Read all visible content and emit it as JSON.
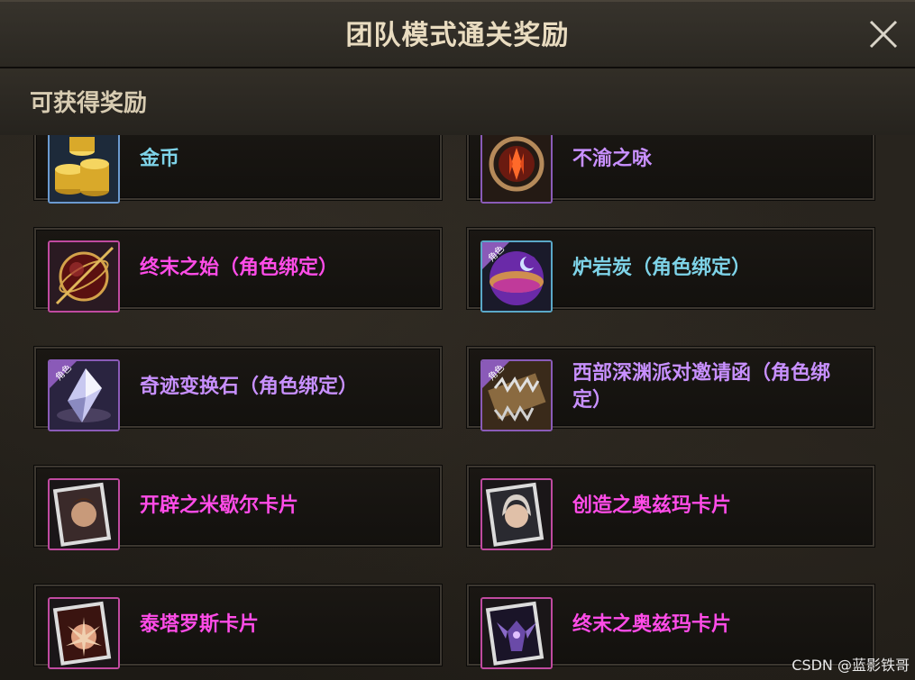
{
  "dialog": {
    "title": "团队模式通关奖励",
    "section_label": "可获得奖励"
  },
  "rewards": [
    {
      "name": "金币",
      "icon": "gold-coins-icon",
      "color": "#7ed3e8"
    },
    {
      "name": "不渝之咏",
      "icon": "ember-emblem-icon",
      "color": "#c890ff"
    },
    {
      "name": "终末之始（角色绑定）",
      "icon": "armillary-sphere-icon",
      "color": "#ff4ce8"
    },
    {
      "name": "炉岩炭（角色绑定）",
      "icon": "purple-orb-icon",
      "color": "#7ed3e8"
    },
    {
      "name": "奇迹变换石（角色绑定）",
      "icon": "crystal-icon",
      "color": "#c890ff"
    },
    {
      "name": "西部深渊派对邀请函（角色绑定）",
      "icon": "spiked-letter-icon",
      "color": "#c890ff"
    },
    {
      "name": "开辟之米歇尔卡片",
      "icon": "portrait-card-icon",
      "color": "#ff4ce8"
    },
    {
      "name": "创造之奥兹玛卡片",
      "icon": "portrait-card-icon",
      "color": "#ff4ce8"
    },
    {
      "name": "泰塔罗斯卡片",
      "icon": "burst-card-icon",
      "color": "#ff4ce8"
    },
    {
      "name": "终末之奥兹玛卡片",
      "icon": "demon-card-icon",
      "color": "#ff4ce8"
    }
  ],
  "icon_badge": "角色",
  "watermark": "CSDN @蓝影铁哥"
}
